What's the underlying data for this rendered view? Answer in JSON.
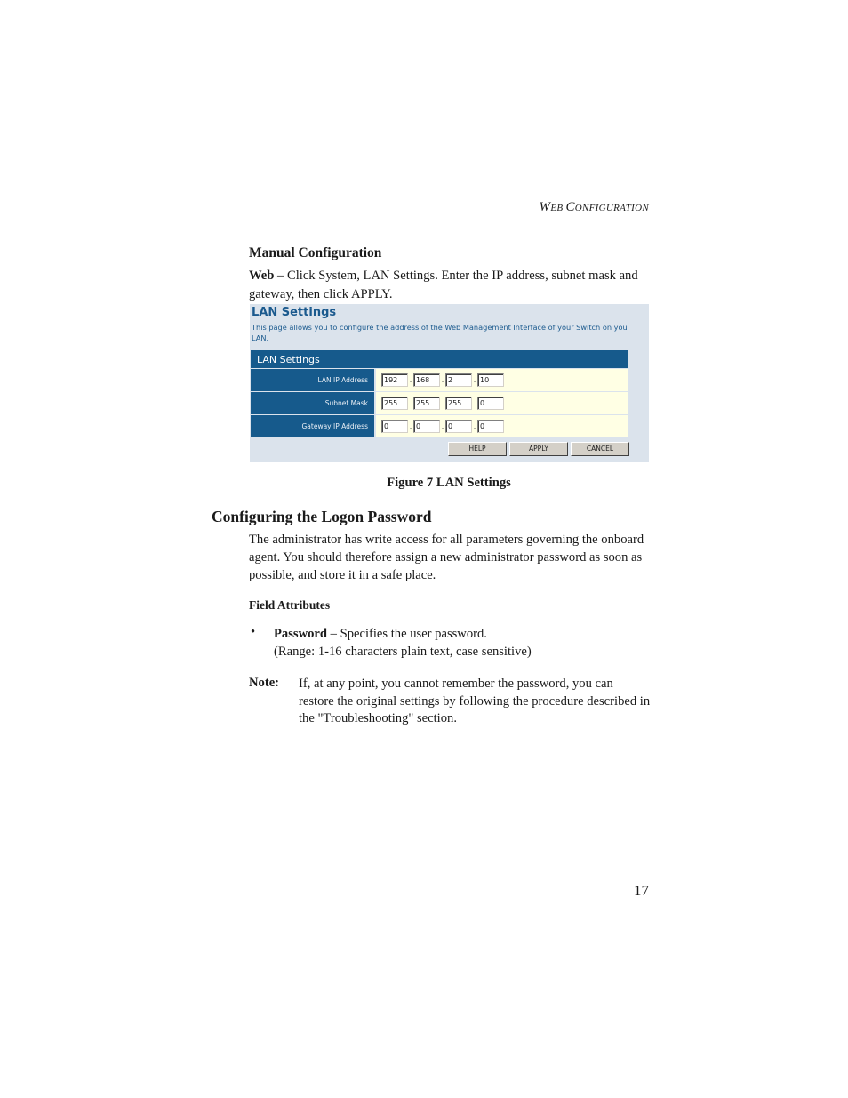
{
  "running_head": {
    "first": "W",
    "rest": "EB ",
    "first2": "C",
    "rest2": "ONFIGURATION"
  },
  "manual_config": {
    "heading": "Manual Configuration",
    "web_label": "Web",
    "web_text": " – Click System, LAN Settings. Enter the IP address, subnet mask and gateway, then click APPLY."
  },
  "screenshot": {
    "title": "LAN Settings",
    "description": "This page allows you to configure the address of the Web Management Interface of your Switch on you LAN.",
    "table_header": "LAN Settings",
    "rows": [
      {
        "label": "LAN IP Address",
        "octets": [
          "192",
          "168",
          "2",
          "10"
        ]
      },
      {
        "label": "Subnet Mask",
        "octets": [
          "255",
          "255",
          "255",
          "0"
        ]
      },
      {
        "label": "Gateway IP Address",
        "octets": [
          "0",
          "0",
          "0",
          "0"
        ]
      }
    ],
    "buttons": {
      "help": "HELP",
      "apply": "APPLY",
      "cancel": "CANCEL"
    },
    "colors": {
      "header": "#165a8c",
      "panel_bg": "#dbe3ec",
      "field_bg": "#ffffe4",
      "title": "#1b5a8e"
    }
  },
  "figure_caption": "Figure 7  LAN Settings",
  "logon": {
    "heading": "Configuring the Logon Password",
    "paragraph": "The administrator has write access for all parameters governing the onboard agent. You should therefore assign a new administrator password as soon as possible, and store it in a safe place.",
    "field_attributes_heading": "Field Attributes",
    "bullet_symbol": "•",
    "bullet_label": "Password",
    "bullet_text": " – Specifies the user password.",
    "bullet_range": "(Range: 1-16 characters plain text, case sensitive)",
    "note_label": "Note:",
    "note_text": "If, at any point, you cannot remember the password, you can restore the original settings by following the procedure described in the \"Troubleshooting\" section."
  },
  "page_number": "17"
}
